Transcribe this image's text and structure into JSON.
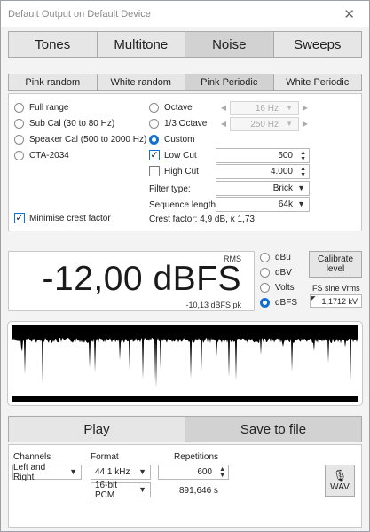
{
  "window": {
    "title": "Default Output on Default Device",
    "close_glyph": "✕"
  },
  "main_tabs": [
    "Tones",
    "Multitone",
    "Noise",
    "Sweeps"
  ],
  "main_tab_selected": 2,
  "sub_tabs": [
    "Pink random",
    "White random",
    "Pink Periodic",
    "White Periodic"
  ],
  "sub_tab_selected": 2,
  "band_options": [
    "Full range",
    "Sub Cal (30 to 80 Hz)",
    "Speaker Cal (500 to 2000 Hz)",
    "CTA-2034"
  ],
  "minimise_crest": "Minimise crest factor",
  "octave": {
    "label": "Octave",
    "value": "16 Hz"
  },
  "third_octave": {
    "label": "1/3 Octave",
    "value": "250 Hz"
  },
  "custom": {
    "label": "Custom",
    "selected": true
  },
  "low_cut": {
    "label": "Low Cut",
    "value": "500",
    "checked": true
  },
  "high_cut": {
    "label": "High Cut",
    "value": "4.000",
    "checked": false
  },
  "filter_type": {
    "label": "Filter type:",
    "value": "Brick"
  },
  "sequence_length": {
    "label": "Sequence length:",
    "value": "64k"
  },
  "crest_factor": "Crest factor: 4,9 dB, κ 1,73",
  "level": {
    "rms_label": "RMS",
    "value": "-12,00 dBFS",
    "peak": "-10,13 dBFS pk"
  },
  "units": [
    "dBu",
    "dBV",
    "Volts",
    "dBFS"
  ],
  "units_selected": 3,
  "calibrate": {
    "line1": "Calibrate",
    "line2": "level"
  },
  "fs_sine": {
    "label": "FS sine Vrms",
    "value": "1,1712 kV"
  },
  "play_label": "Play",
  "save_label": "Save to file",
  "channels": {
    "label": "Channels",
    "value": "Left and Right"
  },
  "format": {
    "label": "Format",
    "rate": "44.1 kHz",
    "depth": "16-bit PCM"
  },
  "repetitions": {
    "label": "Repetitions",
    "value": "600",
    "duration": "891,646 s"
  },
  "wav_label": "WAV",
  "colors": {
    "accent": "#1170cf",
    "tab_selected": "#d2d2d2",
    "scope_bg": "#000000",
    "scope_trace": "#ffffff"
  }
}
